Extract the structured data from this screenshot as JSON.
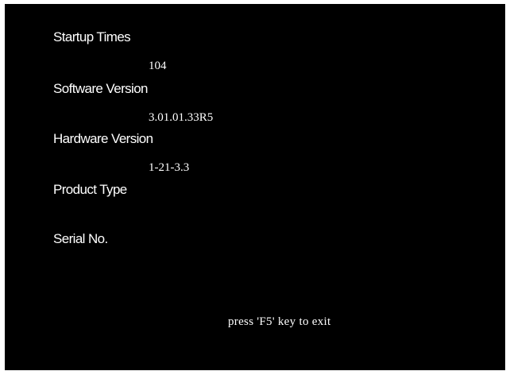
{
  "screen": {
    "background_color": "#000000",
    "text_color": "#ffffff"
  },
  "info": {
    "startup_times": {
      "label": "Startup Times",
      "value": "104"
    },
    "software_version": {
      "label": "Software Version",
      "value": "3.01.01.33R5"
    },
    "hardware_version": {
      "label": "Hardware Version",
      "value": "1-21-3.3"
    },
    "product_type": {
      "label": "Product Type",
      "value": ""
    },
    "serial_no": {
      "label": "Serial No.",
      "value": ""
    }
  },
  "footer": {
    "hint": "press 'F5' key to exit"
  }
}
